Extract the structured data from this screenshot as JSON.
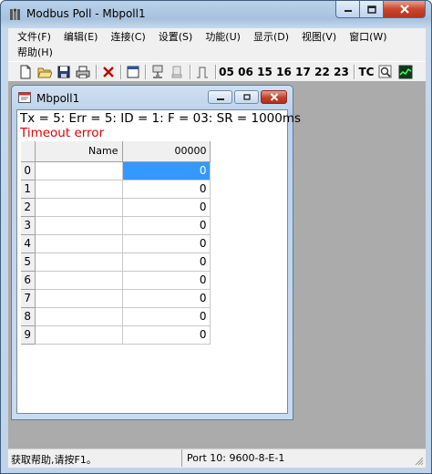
{
  "app": {
    "title": "Modbus Poll - Mbpoll1"
  },
  "menu": {
    "row1": [
      "文件(F)",
      "编辑(E)",
      "连接(C)",
      "设置(S)",
      "功能(U)",
      "显示(D)",
      "视图(V)",
      "窗口(W)"
    ],
    "row2": [
      "帮助(H)"
    ]
  },
  "toolbar": {
    "function_codes": [
      "05",
      "06",
      "15",
      "16",
      "17",
      "22",
      "23"
    ],
    "tc_label": "TC",
    "icons": [
      "new-icon",
      "open-icon",
      "save-icon",
      "print-icon",
      "close-icon",
      "window-icon",
      "connect-icon",
      "disconnect-icon",
      "pulse-icon",
      "search-icon",
      "chart-icon"
    ]
  },
  "child": {
    "title": "Mbpoll1",
    "status_line": "Tx = 5: Err = 5: ID = 1: F = 03: SR = 1000ms",
    "error_line": "Timeout error",
    "columns": {
      "name": "Name",
      "address": "00000"
    },
    "rows": [
      {
        "index": "0",
        "name": "",
        "value": "0"
      },
      {
        "index": "1",
        "name": "",
        "value": "0"
      },
      {
        "index": "2",
        "name": "",
        "value": "0"
      },
      {
        "index": "3",
        "name": "",
        "value": "0"
      },
      {
        "index": "4",
        "name": "",
        "value": "0"
      },
      {
        "index": "5",
        "name": "",
        "value": "0"
      },
      {
        "index": "6",
        "name": "",
        "value": "0"
      },
      {
        "index": "7",
        "name": "",
        "value": "0"
      },
      {
        "index": "8",
        "name": "",
        "value": "0"
      },
      {
        "index": "9",
        "name": "",
        "value": "0"
      }
    ]
  },
  "statusbar": {
    "help_text": "获取帮助,请按F1。",
    "port_text": "Port 10: 9600-8-E-1"
  },
  "colors": {
    "selected_cell": "#3399ff",
    "error_text": "#e00000",
    "mdi_background": "#ababab"
  }
}
